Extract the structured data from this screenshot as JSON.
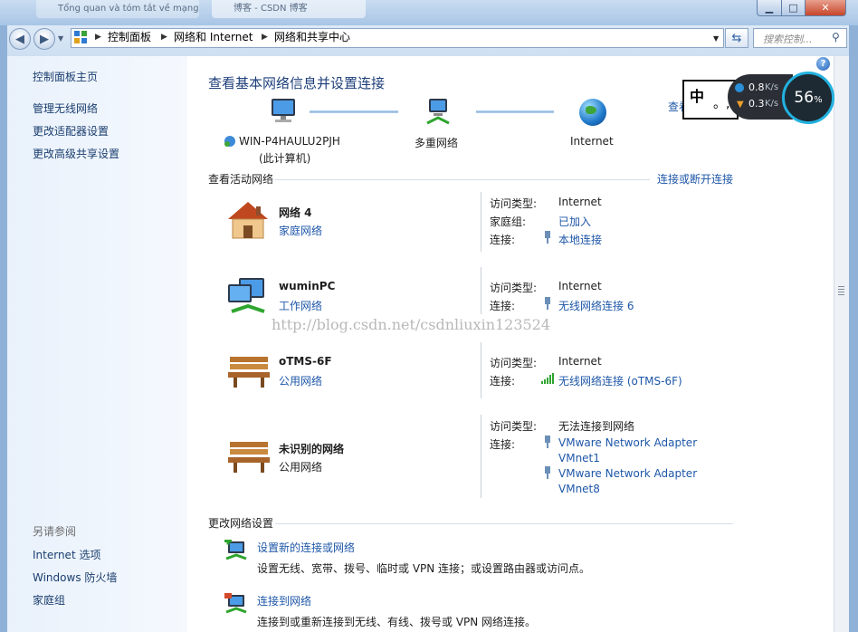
{
  "window": {
    "bg_tab1": "Tổng quan và tóm tắt về mạng",
    "bg_tab2": "博客 - CSDN 博客",
    "minimize": "▁",
    "maximize": "□",
    "close": "✕"
  },
  "address": {
    "crumbs": [
      "控制面板",
      "网络和 Internet",
      "网络和共享中心"
    ],
    "search_placeholder": "搜索控制...",
    "refresh_icon": "refresh-icon"
  },
  "sidebar": {
    "home": "控制面板主页",
    "tasks": [
      "管理无线网络",
      "更改适配器设置",
      "更改高级共享设置"
    ],
    "see_also_title": "另请参阅",
    "see_also": [
      "Internet 选项",
      "Windows 防火墙",
      "家庭组"
    ]
  },
  "main": {
    "title": "查看基本网络信息并设置连接",
    "view_full_map": "查看",
    "map": {
      "computer_name": "WIN-P4HAULU2PJH",
      "computer_sub": "(此计算机)",
      "middle": "多重网络",
      "right": "Internet"
    },
    "active_section": "查看活动网络",
    "connect_disconnect": "连接或断开连接",
    "networks": [
      {
        "name": "网络  4",
        "type": "家庭网络",
        "type_link": true,
        "rows": [
          {
            "label": "访问类型:",
            "value": "Internet",
            "link": false
          },
          {
            "label": "家庭组:",
            "value": "已加入",
            "link": true
          },
          {
            "label": "连接:",
            "value": "本地连接",
            "link": true
          }
        ]
      },
      {
        "name": "wuminPC",
        "type": "工作网络",
        "type_link": true,
        "rows": [
          {
            "label": "访问类型:",
            "value": "Internet",
            "link": false
          },
          {
            "label": "连接:",
            "value": "无线网络连接 6",
            "link": true
          }
        ]
      },
      {
        "name": "oTMS-6F",
        "type": "公用网络",
        "type_link": true,
        "rows": [
          {
            "label": "访问类型:",
            "value": "Internet",
            "link": false
          },
          {
            "label": "连接:",
            "value": "无线网络连接 (oTMS-6F)",
            "link": true
          }
        ]
      },
      {
        "name": "未识别的网络",
        "type": "公用网络",
        "type_link": false,
        "rows": [
          {
            "label": "访问类型:",
            "value": "无法连接到网络",
            "link": false
          },
          {
            "label": "连接:",
            "value": "VMware Network Adapter",
            "link": true
          },
          {
            "label": "",
            "value": "VMnet1",
            "link": true
          },
          {
            "label": "",
            "value": "VMware Network Adapter",
            "link": true
          },
          {
            "label": "",
            "value": "VMnet8",
            "link": true
          }
        ]
      }
    ],
    "change_section": "更改网络设置",
    "tasks": [
      {
        "title": "设置新的连接或网络",
        "desc": "设置无线、宽带、拨号、临时或 VPN 连接；或设置路由器或访问点。"
      },
      {
        "title": "连接到网络",
        "desc": "连接到或重新连接到无线、有线、拨号或 VPN 网络连接。"
      }
    ]
  },
  "watermark": "http://blog.csdn.net/csdnliuxin123524",
  "widget": {
    "ime": "中",
    "ime_punct": "。,",
    "up": "0.8",
    "down": "0.3",
    "unit": "K/s",
    "percent": "56",
    "percent_sign": "%"
  },
  "help": "?"
}
